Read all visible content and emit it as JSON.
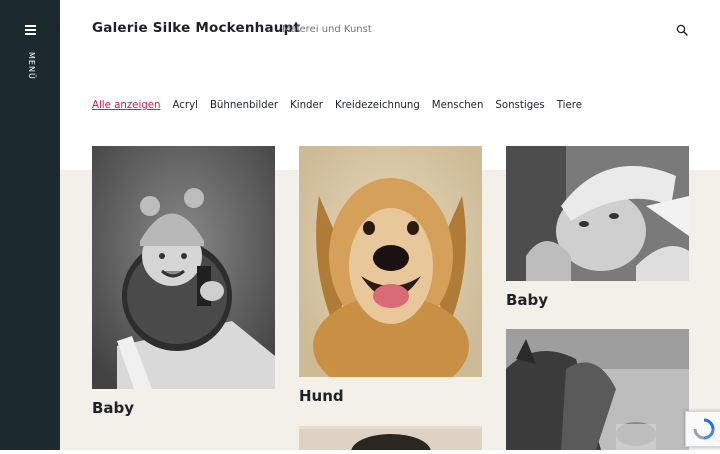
{
  "sidebar": {
    "menu_label": "Menü"
  },
  "header": {
    "title": "Galerie Silke Mockenhaupt",
    "tagline": "Malerei und Kunst"
  },
  "filters": [
    {
      "label": "Alle anzeigen",
      "active": true
    },
    {
      "label": "Acryl"
    },
    {
      "label": "Bühnenbilder"
    },
    {
      "label": "Kinder"
    },
    {
      "label": "Kreidezeichnung"
    },
    {
      "label": "Menschen"
    },
    {
      "label": "Sonstiges"
    },
    {
      "label": "Tiere"
    }
  ],
  "gallery": [
    {
      "title": "Baby",
      "image": "baby-in-knit-hat-drawing"
    },
    {
      "title": "Hund",
      "image": "golden-retriever-painting"
    },
    {
      "title": "Baby",
      "image": "newborn-baby-drawing"
    },
    {
      "title": "",
      "image": "child-portrait-painting-partial"
    },
    {
      "title": "",
      "image": "horse-and-child-drawing-partial"
    }
  ],
  "colors": {
    "sidebar": "#1c2a30",
    "accent": "#c81d4e",
    "beige": "#f3efe9"
  }
}
